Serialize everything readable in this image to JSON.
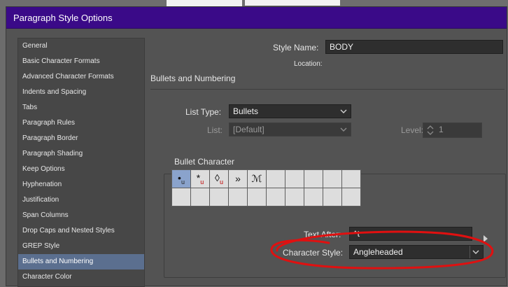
{
  "dialog": {
    "title": "Paragraph Style Options"
  },
  "sidebar": {
    "items": [
      {
        "label": "General"
      },
      {
        "label": "Basic Character Formats"
      },
      {
        "label": "Advanced Character Formats"
      },
      {
        "label": "Indents and Spacing"
      },
      {
        "label": "Tabs"
      },
      {
        "label": "Paragraph Rules"
      },
      {
        "label": "Paragraph Border"
      },
      {
        "label": "Paragraph Shading"
      },
      {
        "label": "Keep Options"
      },
      {
        "label": "Hyphenation"
      },
      {
        "label": "Justification"
      },
      {
        "label": "Span Columns"
      },
      {
        "label": "Drop Caps and Nested Styles"
      },
      {
        "label": "GREP Style"
      },
      {
        "label": "Bullets and Numbering"
      },
      {
        "label": "Character Color"
      }
    ],
    "selected": "Bullets and Numbering"
  },
  "main": {
    "style_name_label": "Style Name:",
    "style_name_value": "BODY",
    "location_label": "Location:",
    "section_title": "Bullets and Numbering",
    "list_type_label": "List Type:",
    "list_type_value": "Bullets",
    "list_label": "List:",
    "list_value": "[Default]",
    "level_label": "Level:",
    "level_value": "1",
    "bullet_group_title": "Bullet Character",
    "text_after_label": "Text After:",
    "text_after_value": "^t",
    "char_style_label": "Character Style:",
    "char_style_value": "Angleheaded"
  },
  "bullets": {
    "glyphs": [
      "•",
      "*",
      "◊",
      "»",
      "ℳ"
    ],
    "sub_mark": "u",
    "selected_index": 0,
    "columns": 10
  },
  "colors": {
    "titlebar": "#3a0a88",
    "selection": "#5b6f8f",
    "annotation": "#e01010"
  }
}
